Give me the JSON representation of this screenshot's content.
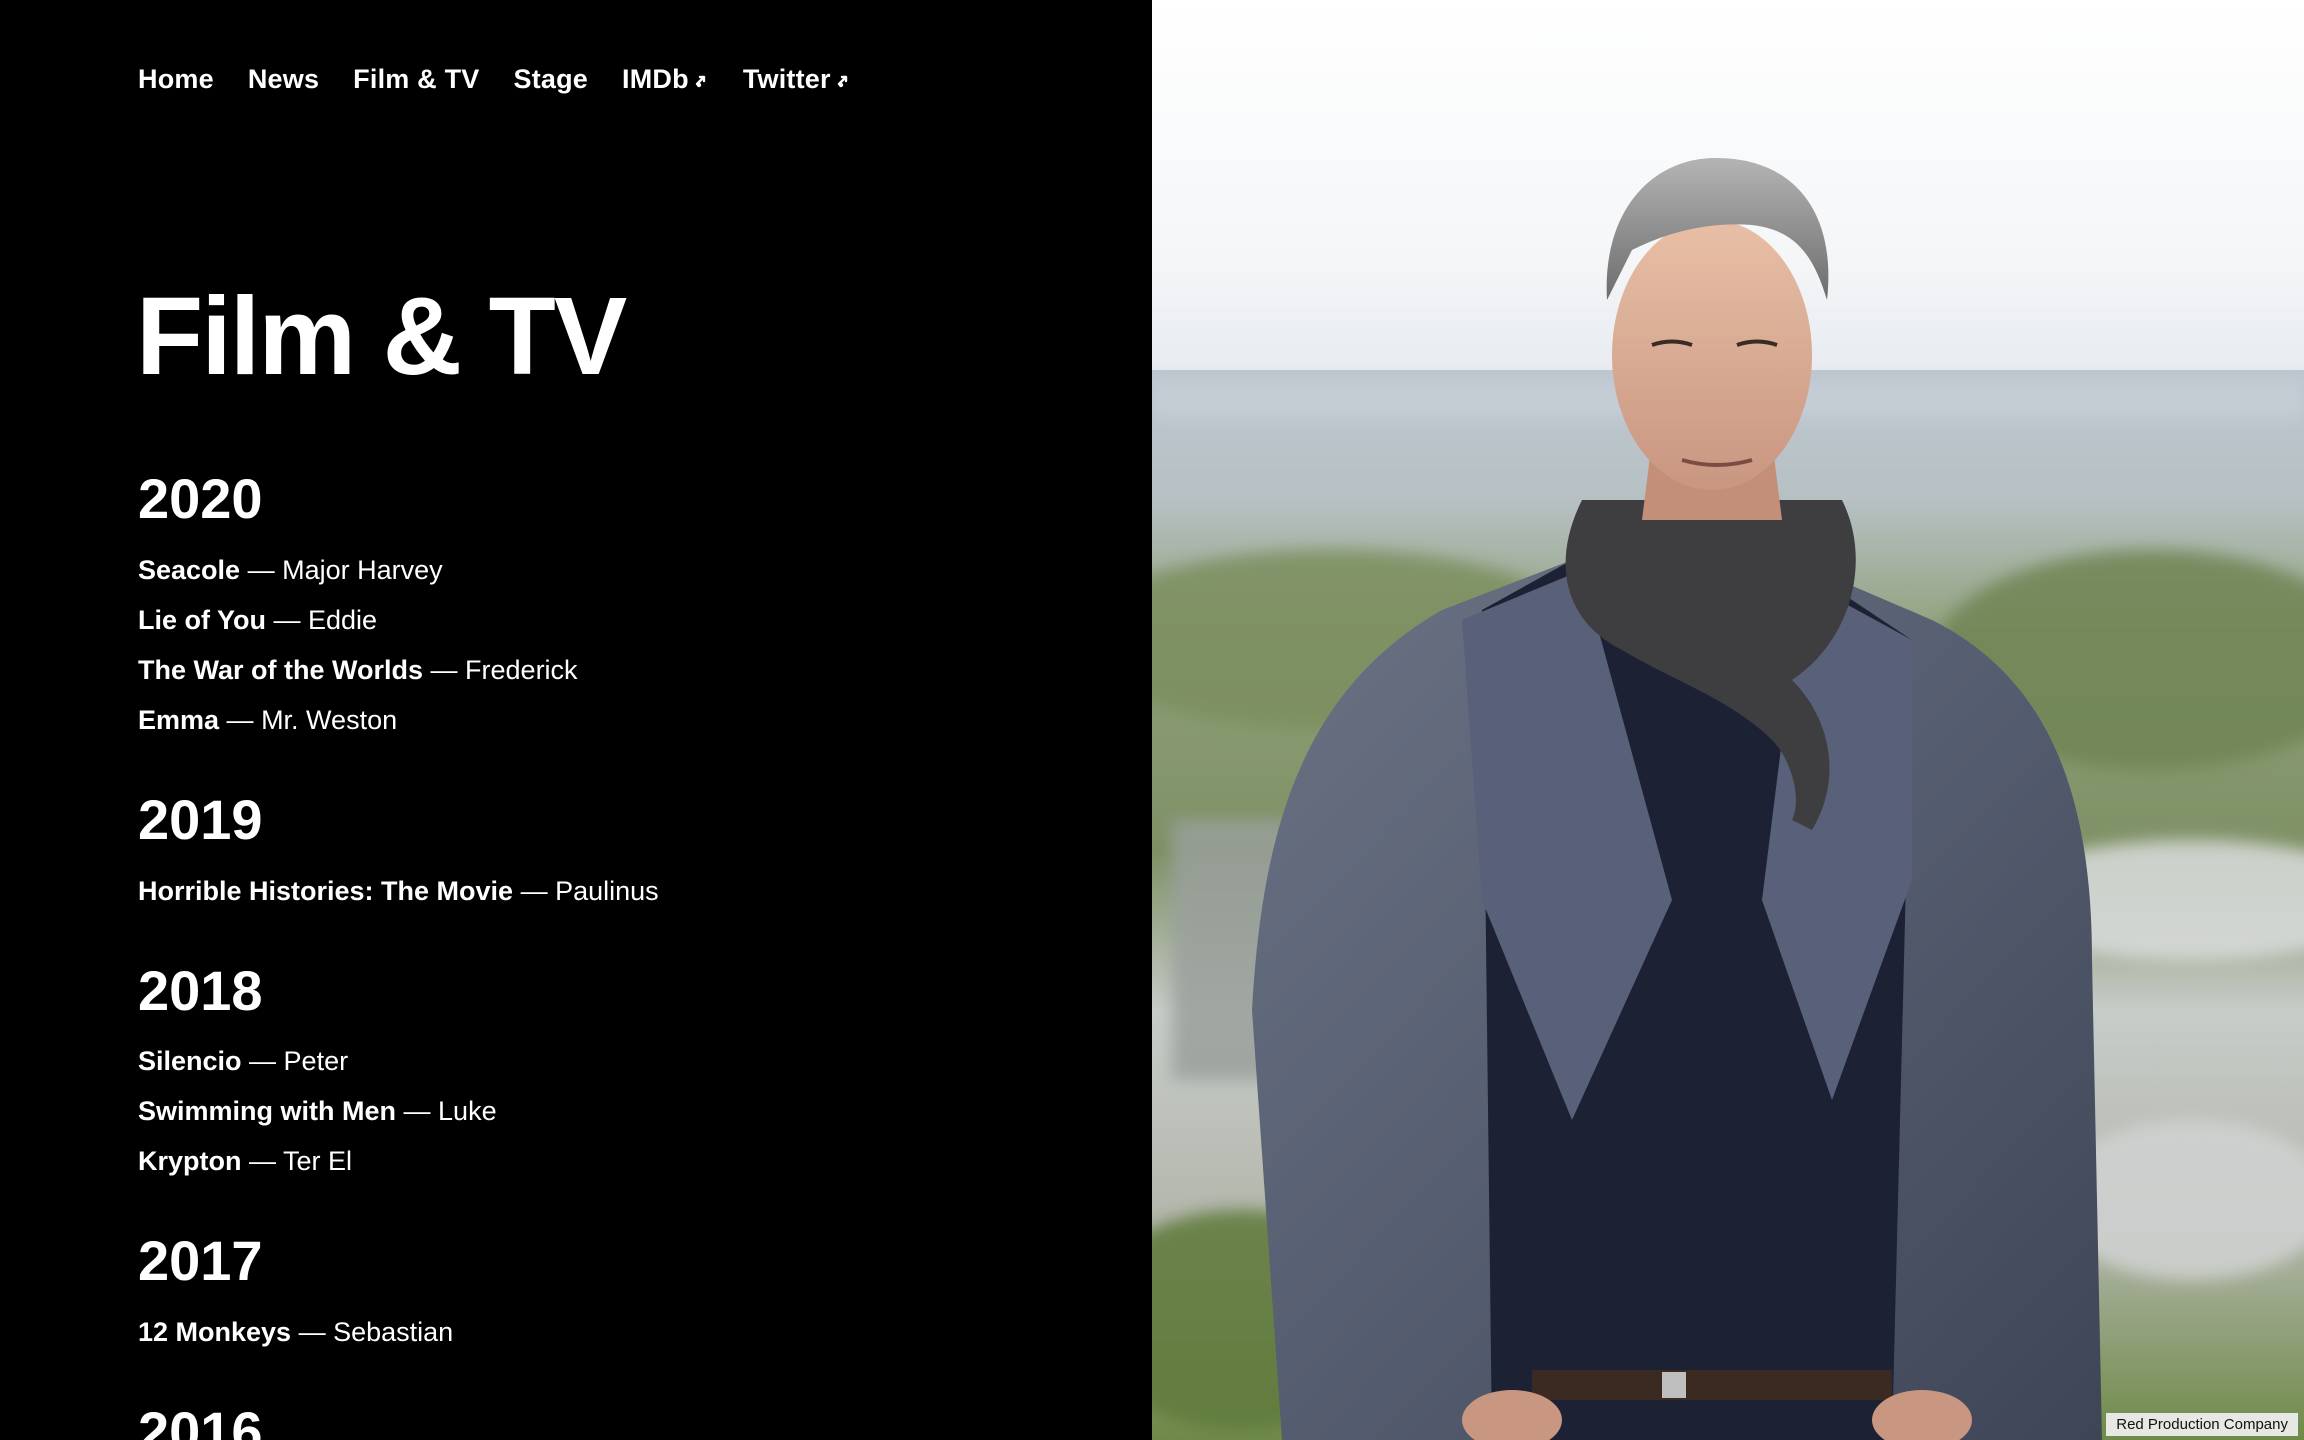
{
  "nav": {
    "items": [
      {
        "label": "Home",
        "external": false
      },
      {
        "label": "News",
        "external": false
      },
      {
        "label": "Film & TV",
        "external": false
      },
      {
        "label": "Stage",
        "external": false
      },
      {
        "label": "IMDb",
        "external": true
      },
      {
        "label": "Twitter",
        "external": true
      }
    ]
  },
  "page": {
    "title": "Film & TV"
  },
  "filmography": [
    {
      "year": "2020",
      "credits": [
        {
          "title": "Seacole",
          "sep": " — ",
          "role": "Major Harvey"
        },
        {
          "title": "Lie of You",
          "sep": " — ",
          "role": "Eddie"
        },
        {
          "title": "The War of the Worlds",
          "sep": " — ",
          "role": "Frederick"
        },
        {
          "title": "Emma",
          "sep": " — ",
          "role": "Mr. Weston"
        }
      ]
    },
    {
      "year": "2019",
      "credits": [
        {
          "title": "Horrible Histories: The Movie",
          "sep": " — ",
          "role": "Paulinus"
        }
      ]
    },
    {
      "year": "2018",
      "credits": [
        {
          "title": "Silencio",
          "sep": " — ",
          "role": "Peter"
        },
        {
          "title": "Swimming with Men",
          "sep": " — ",
          "role": "Luke"
        },
        {
          "title": "Krypton",
          "sep": " — ",
          "role": "Ter El"
        }
      ]
    },
    {
      "year": "2017",
      "credits": [
        {
          "title": "12 Monkeys",
          "sep": " — ",
          "role": "Sebastian"
        }
      ]
    },
    {
      "year": "2016",
      "credits": []
    }
  ],
  "photo": {
    "credit": "Red Production Company"
  },
  "colors": {
    "background": "#000000",
    "text": "#ffffff"
  }
}
